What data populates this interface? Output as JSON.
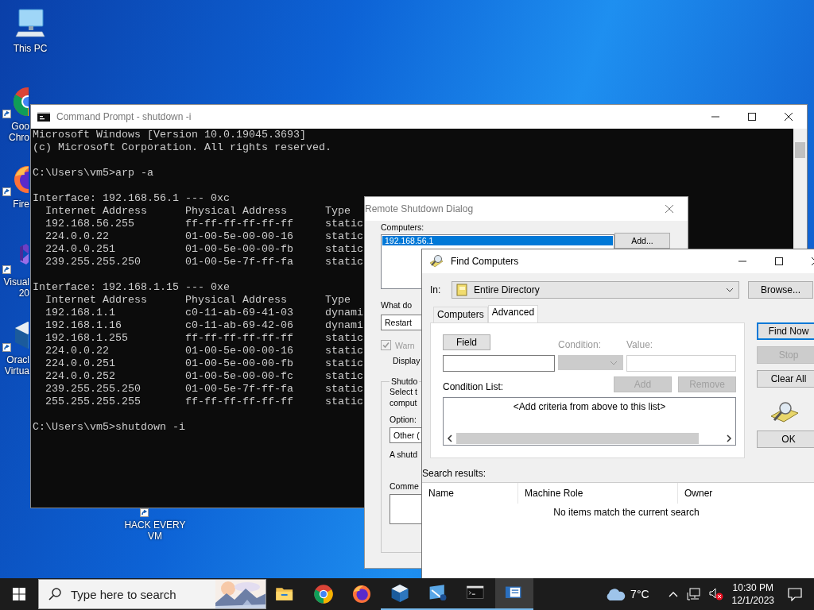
{
  "desktop_icons": [
    {
      "kind": "pc",
      "lines": [
        "This PC"
      ],
      "shortcut": false
    },
    {
      "kind": "chrome",
      "lines": [
        "Goo",
        "Chro"
      ],
      "shortcut": true
    },
    {
      "kind": "firefox",
      "lines": [
        "Fire"
      ],
      "shortcut": true
    },
    {
      "kind": "vs",
      "lines": [
        "Visual",
        "20"
      ],
      "shortcut": true
    },
    {
      "kind": "vbox",
      "lines": [
        "Oracl",
        "Virtua"
      ],
      "shortcut": true
    }
  ],
  "desktop_file": {
    "lines": [
      "HACK EVERY",
      "VM"
    ],
    "shortcut": true
  },
  "command_prompt": {
    "title": "Command Prompt - shutdown  -i",
    "blocks": [
      [
        "Microsoft Windows [Version 10.0.19045.3693]",
        "(c) Microsoft Corporation. All rights reserved."
      ],
      [
        "C:\\Users\\vm5>arp -a"
      ],
      [
        "Interface: 192.168.56.1 --- 0xc",
        "  Internet Address      Physical Address      Type",
        "  192.168.56.255        ff-ff-ff-ff-ff-ff     static",
        "  224.0.0.22            01-00-5e-00-00-16     static",
        "  224.0.0.251           01-00-5e-00-00-fb     static",
        "  239.255.255.250       01-00-5e-7f-ff-fa     static"
      ],
      [
        "Interface: 192.168.1.15 --- 0xe",
        "  Internet Address      Physical Address      Type",
        "  192.168.1.1           c0-11-ab-69-41-03     dynami",
        "  192.168.1.16          c0-11-ab-69-42-06     dynami",
        "  192.168.1.255         ff-ff-ff-ff-ff-ff     static",
        "  224.0.0.22            01-00-5e-00-00-16     static",
        "  224.0.0.251           01-00-5e-00-00-fb     static",
        "  224.0.0.252           01-00-5e-00-00-fc     static",
        "  239.255.255.250       01-00-5e-7f-ff-fa     static",
        "  255.255.255.255       ff-ff-ff-ff-ff-ff     static"
      ],
      [
        "C:\\Users\\vm5>shutdown -i"
      ]
    ]
  },
  "remote_shutdown": {
    "title": "Remote Shutdown Dialog",
    "computers_label": "Computers:",
    "computers": [
      {
        "name": "192.168.56.1",
        "selected": true
      }
    ],
    "add_button": "Add...",
    "action_label": "What do",
    "action_value": "Restart",
    "warn": {
      "label": "Warn",
      "checked": true,
      "disabled": true
    },
    "display_label": "Display",
    "group_title": "Shutdo",
    "group_lines": [
      "Select t",
      "comput"
    ],
    "option_label": "Option:",
    "option_value": "Other (",
    "note": "A shutd",
    "comment_label": "Comme"
  },
  "find_computers": {
    "title": "Find Computers",
    "in_label": "In:",
    "in_value": "Entire Directory",
    "browse_button": "Browse...",
    "tabs": [
      {
        "label": "Computers",
        "selected": false
      },
      {
        "label": "Advanced",
        "selected": true
      }
    ],
    "field_button": "Field",
    "condition_label": "Condition:",
    "value_label": "Value:",
    "condition_list_label": "Condition List:",
    "list_buttons": [
      {
        "label": "Add",
        "disabled": true
      },
      {
        "label": "Remove",
        "disabled": true
      }
    ],
    "condition_placeholder": "<Add criteria from above to this list>",
    "side_buttons": [
      {
        "label": "Find Now",
        "disabled": false,
        "default": true
      },
      {
        "label": "Stop",
        "disabled": true,
        "default": false
      },
      {
        "label": "Clear All",
        "disabled": false,
        "default": false
      },
      {
        "label": "OK",
        "disabled": false,
        "default": false
      }
    ],
    "results_label": "Search results:",
    "results_columns": [
      "Name",
      "Machine Role",
      "Owner"
    ],
    "empty_text": "No items match the current search"
  },
  "taskbar": {
    "search_placeholder": "Type here to search",
    "apps": [
      {
        "kind": "explorer",
        "open": false,
        "active": false
      },
      {
        "kind": "chrome",
        "open": false,
        "active": false
      },
      {
        "kind": "firefox",
        "open": false,
        "active": false
      },
      {
        "kind": "vbox",
        "open": true,
        "active": false
      },
      {
        "kind": "app8",
        "open": true,
        "active": false
      },
      {
        "kind": "cmd",
        "open": true,
        "active": false
      },
      {
        "kind": "dialog",
        "open": true,
        "active": true
      }
    ],
    "weather": "7°C",
    "time": "10:30 PM",
    "date": "12/1/2023"
  }
}
